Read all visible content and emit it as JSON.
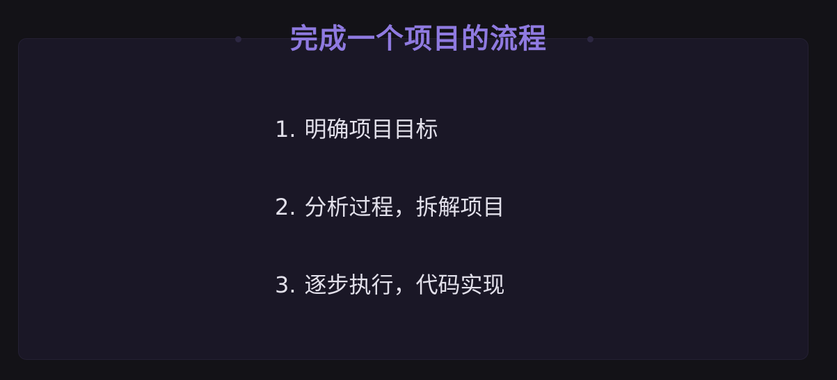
{
  "slide": {
    "title": "完成一个项目的流程",
    "steps": [
      {
        "number": "1.",
        "text": "明确项目目标"
      },
      {
        "number": "2.",
        "text": "分析过程，拆解项目"
      },
      {
        "number": "3.",
        "text": "逐步执行，代码实现"
      }
    ]
  },
  "colors": {
    "background": "#131217",
    "panel": "#1a1726",
    "title": "#8f7ae0",
    "text": "#e2e0ea"
  }
}
